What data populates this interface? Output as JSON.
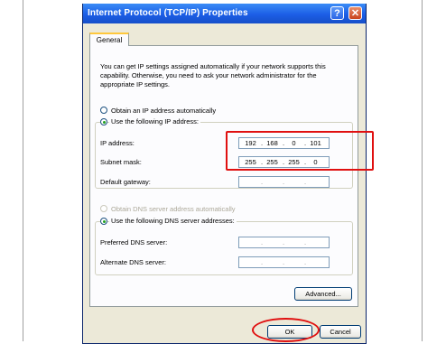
{
  "window": {
    "title": "Internet Protocol (TCP/IP) Properties",
    "help_label": "?",
    "close_label": "✕"
  },
  "tab": {
    "label": "General"
  },
  "intro_text": "You can get IP settings assigned automatically if your network supports this capability. Otherwise, you need to ask your network administrator for the appropriate IP settings.",
  "ip": {
    "obtain_auto_label": "Obtain an IP address automatically",
    "use_following_label": "Use the following IP address:",
    "selected": "use_following",
    "fields": [
      {
        "label": "IP address:",
        "octets": [
          "192",
          "168",
          "0",
          "101"
        ]
      },
      {
        "label": "Subnet mask:",
        "octets": [
          "255",
          "255",
          "255",
          "0"
        ]
      },
      {
        "label": "Default gateway:",
        "octets": [
          "",
          "",
          "",
          ""
        ]
      }
    ]
  },
  "dns": {
    "obtain_auto_label": "Obtain DNS server address automatically",
    "use_following_label": "Use the following DNS server addresses:",
    "selected": "use_following",
    "fields": [
      {
        "label": "Preferred DNS server:",
        "octets": [
          "",
          "",
          "",
          ""
        ]
      },
      {
        "label": "Alternate DNS server:",
        "octets": [
          "",
          "",
          "",
          ""
        ]
      }
    ]
  },
  "buttons": {
    "advanced": "Advanced...",
    "ok": "OK",
    "cancel": "Cancel"
  },
  "colors": {
    "highlight": "#e01010",
    "titlebar": "#1c5ee6"
  },
  "icons": {
    "help": "help-icon",
    "close": "close-icon"
  }
}
